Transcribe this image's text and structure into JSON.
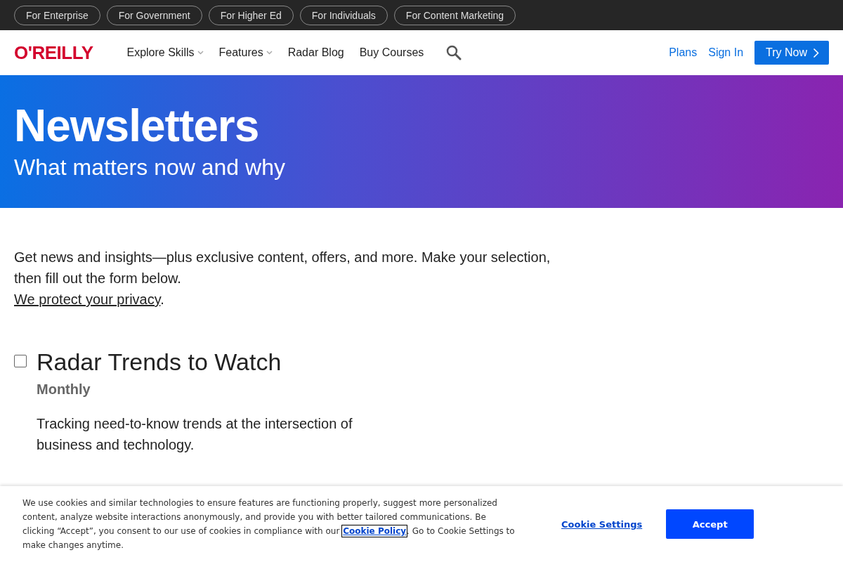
{
  "audience_links": [
    "For Enterprise",
    "For Government",
    "For Higher Ed",
    "For Individuals",
    "For Content Marketing"
  ],
  "logo": "O'REILLY",
  "nav": [
    {
      "label": "Explore Skills",
      "dropdown": true
    },
    {
      "label": "Features",
      "dropdown": true
    },
    {
      "label": "Radar Blog",
      "dropdown": false
    },
    {
      "label": "Buy Courses",
      "dropdown": false
    }
  ],
  "account_links": [
    "Plans",
    "Sign In"
  ],
  "cta": "Try Now",
  "hero": {
    "title": "Newsletters",
    "subtitle": "What matters now and why"
  },
  "intro": {
    "text": "Get news and insights—plus exclusive content, offers, and more. Make your selection, then fill out the form below.",
    "link": "We protect your privacy",
    "after": "."
  },
  "newsletters": [
    {
      "name": "Radar Trends to Watch",
      "frequency": "Monthly",
      "description": "Tracking need-to-know trends at the intersection of business and technology.",
      "checked": false
    }
  ],
  "cookie_banner": {
    "text_before": "We use cookies and similar technologies to ensure features are functioning properly, suggest more personalized content, analyze website interactions anonymously, and provide you with better tailored communications. Be clicking “Accept”, you consent to our use of cookies in compliance with our",
    "link": "Cookie Policy",
    "text_after": ". Go to Cookie Settings to make changes anytime.",
    "settings": "Cookie Settings",
    "accept": "Accept"
  }
}
